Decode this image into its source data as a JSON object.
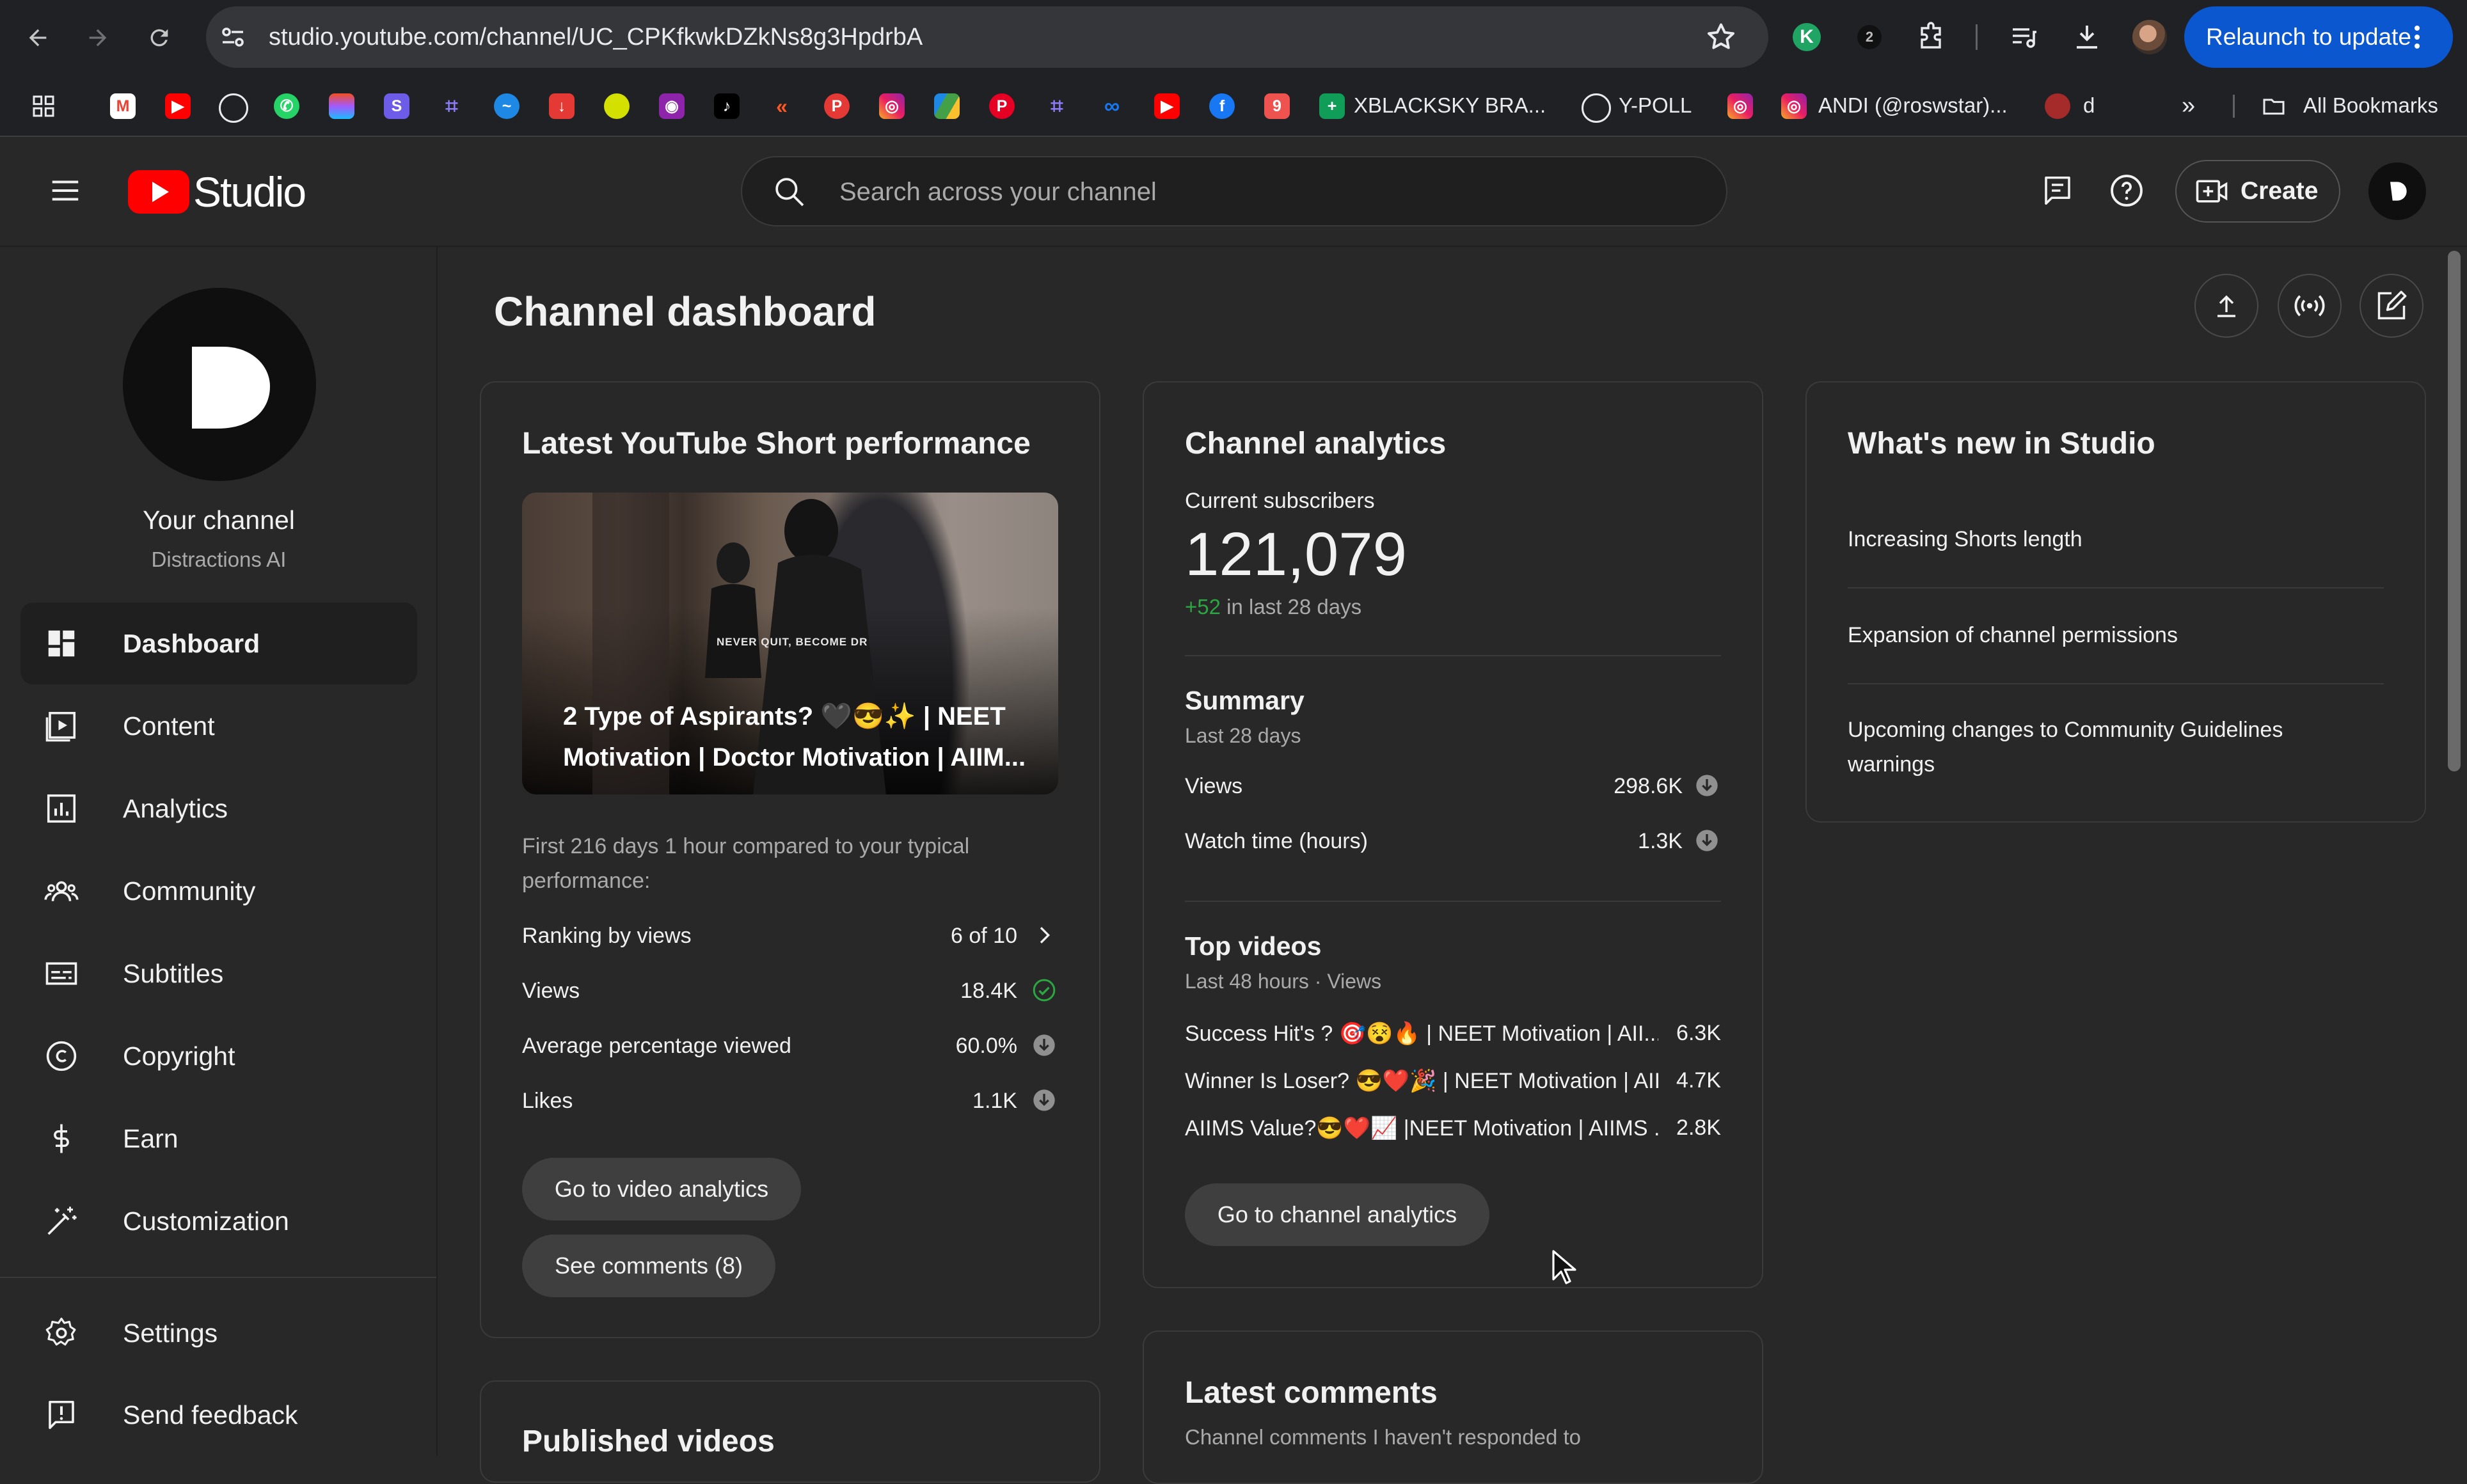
{
  "browser": {
    "url": "studio.youtube.com/channel/UC_CPKfkwkDZkNs8g3HpdrbA",
    "relaunch_label": "Relaunch to update",
    "bookmarks": {
      "xblacksky": "XBLACKSKY BRA...",
      "ypoll": "Y-POLL",
      "andi": "ANDI (@roswstar)...",
      "d": "d",
      "all_bookmarks": "All Bookmarks"
    }
  },
  "header": {
    "logo_text": "Studio",
    "search_placeholder": "Search across your channel",
    "create_label": "Create"
  },
  "sidebar": {
    "your_channel": "Your channel",
    "channel_name": "Distractions AI",
    "items": [
      {
        "label": "Dashboard",
        "icon": "dashboard-icon"
      },
      {
        "label": "Content",
        "icon": "content-icon"
      },
      {
        "label": "Analytics",
        "icon": "analytics-icon"
      },
      {
        "label": "Community",
        "icon": "community-icon"
      },
      {
        "label": "Subtitles",
        "icon": "subtitles-icon"
      },
      {
        "label": "Copyright",
        "icon": "copyright-icon"
      },
      {
        "label": "Earn",
        "icon": "earn-icon"
      },
      {
        "label": "Customization",
        "icon": "customization-icon"
      }
    ],
    "bottom_items": [
      {
        "label": "Settings",
        "icon": "settings-icon"
      },
      {
        "label": "Send feedback",
        "icon": "feedback-icon"
      }
    ]
  },
  "main": {
    "title": "Channel dashboard",
    "short_card": {
      "title": "Latest YouTube Short performance",
      "thumb_overlay": "NEVER QUIT, BECOME DR",
      "video_title": "2 Type of Aspirants? 🖤😎✨ | NEET Motivation | Doctor Motivation | AIIM...",
      "compare_text": "First 216 days 1 hour compared to your typical performance:",
      "rows": [
        {
          "label": "Ranking by views",
          "value": "6 of 10"
        },
        {
          "label": "Views",
          "value": "18.4K"
        },
        {
          "label": "Average percentage viewed",
          "value": "60.0%"
        },
        {
          "label": "Likes",
          "value": "1.1K"
        }
      ],
      "btn_video_analytics": "Go to video analytics",
      "btn_comments": "See comments (8)"
    },
    "published_card": {
      "title": "Published videos"
    },
    "analytics_card": {
      "title": "Channel analytics",
      "subs_label": "Current subscribers",
      "subs_value": "121,079",
      "subs_delta": "+52",
      "subs_delta_suffix": " in last 28 days",
      "summary_title": "Summary",
      "summary_period": "Last 28 days",
      "summary_rows": [
        {
          "label": "Views",
          "value": "298.6K"
        },
        {
          "label": "Watch time (hours)",
          "value": "1.3K"
        }
      ],
      "top_title": "Top videos",
      "top_period": "Last 48 hours · Views",
      "top_videos": [
        {
          "title": "Success Hit's ? 🎯😵🔥 | NEET Motivation | AII...",
          "views": "6.3K"
        },
        {
          "title": "Winner Is Loser? 😎❤️🎉 | NEET Motivation | AII...",
          "views": "4.7K"
        },
        {
          "title": "AIIMS Value?😎❤️📈 |NEET Motivation | AIIMS ...",
          "views": "2.8K"
        }
      ],
      "btn_channel_analytics": "Go to channel analytics"
    },
    "comments_card": {
      "title": "Latest comments",
      "subtitle": "Channel comments I haven't responded to"
    },
    "news_card": {
      "title": "What's new in Studio",
      "items": [
        "Increasing Shorts length",
        "Expansion of channel permissions",
        "Upcoming changes to Community Guidelines warnings"
      ]
    }
  },
  "colors": {
    "background": "#282828",
    "card_border": "#3a3a3a",
    "youtube_red": "#ff0000",
    "relaunch_blue": "#0b57d0",
    "positive_green": "#2ba640"
  }
}
